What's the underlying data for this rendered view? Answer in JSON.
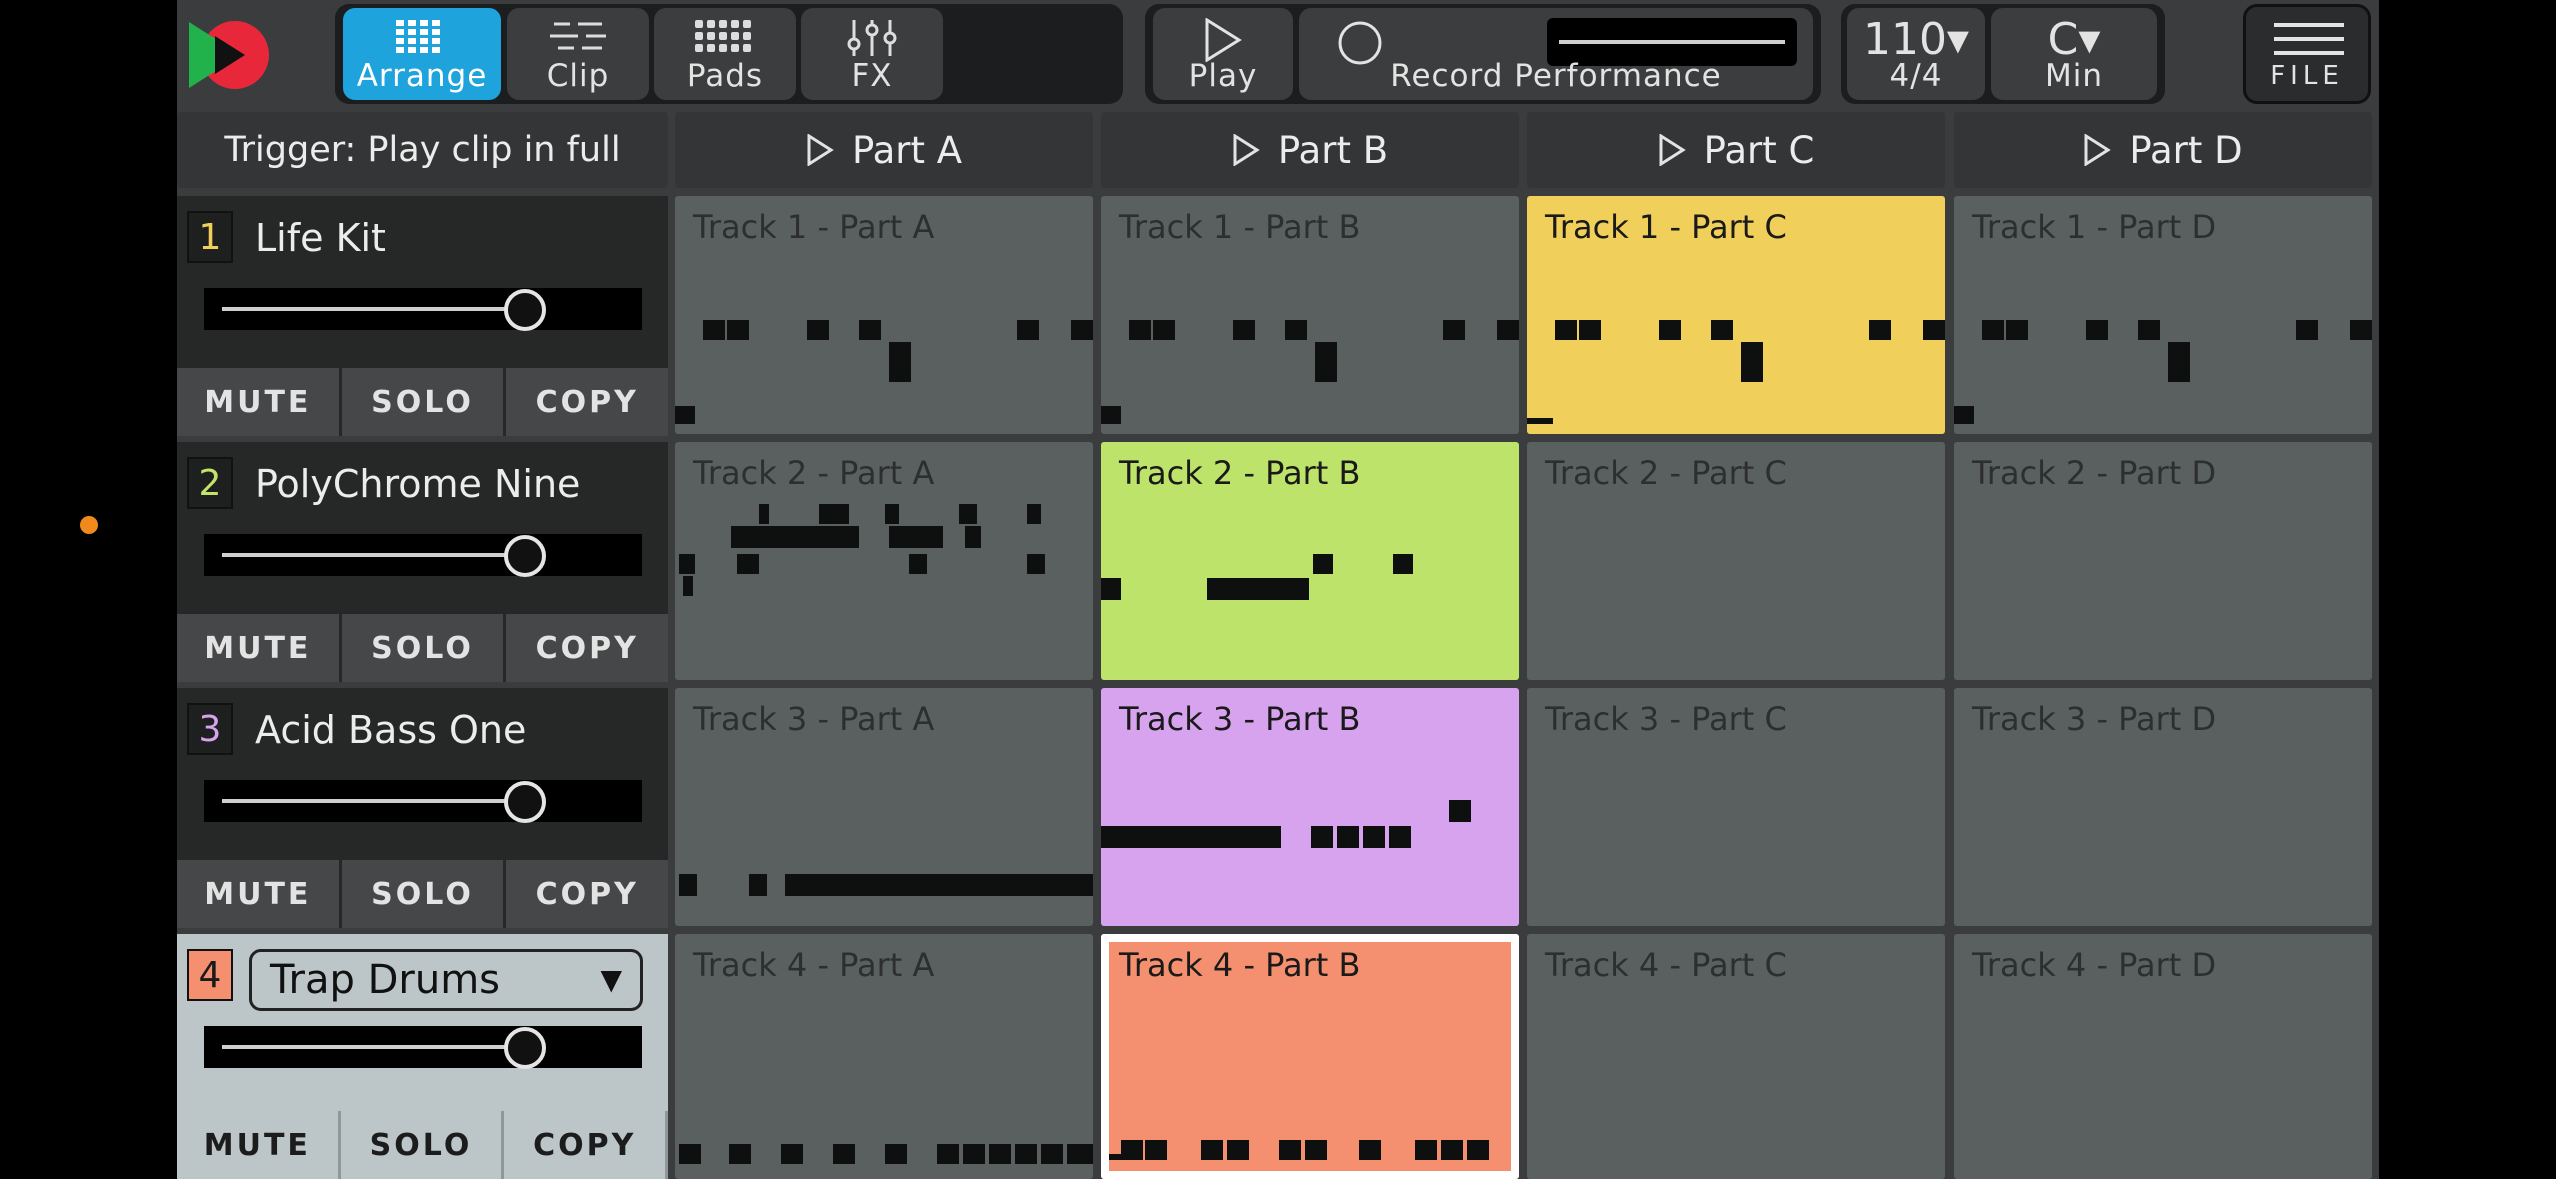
{
  "tabs": [
    {
      "label": "Arrange",
      "icon": "arrange-grid-icon",
      "active": true
    },
    {
      "label": "Clip",
      "icon": "clip-lines-icon",
      "active": false
    },
    {
      "label": "Pads",
      "icon": "pads-grid-icon",
      "active": false
    },
    {
      "label": "FX",
      "icon": "fx-sliders-icon",
      "active": false
    }
  ],
  "transport": {
    "play_label": "Play",
    "record_label": "Record Performance"
  },
  "tempo": {
    "bpm": "110▾",
    "signature": "4/4"
  },
  "key": {
    "note": "C▾",
    "scale": "Min"
  },
  "file_label": "FILE",
  "trigger_label": "Trigger: Play clip in full",
  "parts": [
    "Part A",
    "Part B",
    "Part C",
    "Part D"
  ],
  "track_buttons": {
    "mute": "MUTE",
    "solo": "SOLO",
    "copy": "COPY"
  },
  "tracks": [
    {
      "num": "1",
      "name": "Life Kit",
      "num_color": "#f0cf5a",
      "volume": 0.75
    },
    {
      "num": "2",
      "name": "PolyChrome Nine",
      "num_color": "#c3e36a",
      "volume": 0.75
    },
    {
      "num": "3",
      "name": "Acid Bass One",
      "num_color": "#d7a3ef",
      "volume": 0.75
    },
    {
      "num": "4",
      "name": "Trap Drums",
      "num_color": "#f4906f",
      "volume": 0.75,
      "selected": true
    }
  ],
  "clips": [
    [
      "Track 1 - Part A",
      "Track 1 - Part B",
      "Track 1 - Part C",
      "Track 1 - Part D"
    ],
    [
      "Track 2 - Part A",
      "Track 2 - Part B",
      "Track 2 - Part C",
      "Track 2 - Part D"
    ],
    [
      "Track 3 - Part A",
      "Track 3 - Part B",
      "Track 3 - Part C",
      "Track 3 - Part D"
    ],
    [
      "Track 4 - Part A",
      "Track 4 - Part B",
      "Track 4 - Part C",
      "Track 4 - Part D"
    ]
  ],
  "colors": {
    "accent": "#1fa3dc",
    "clip_idle": "#5a6060",
    "track1": "#f0cf5a",
    "track2": "#bde36a",
    "track3": "#d7a3ef",
    "track4": "#f4906f"
  }
}
